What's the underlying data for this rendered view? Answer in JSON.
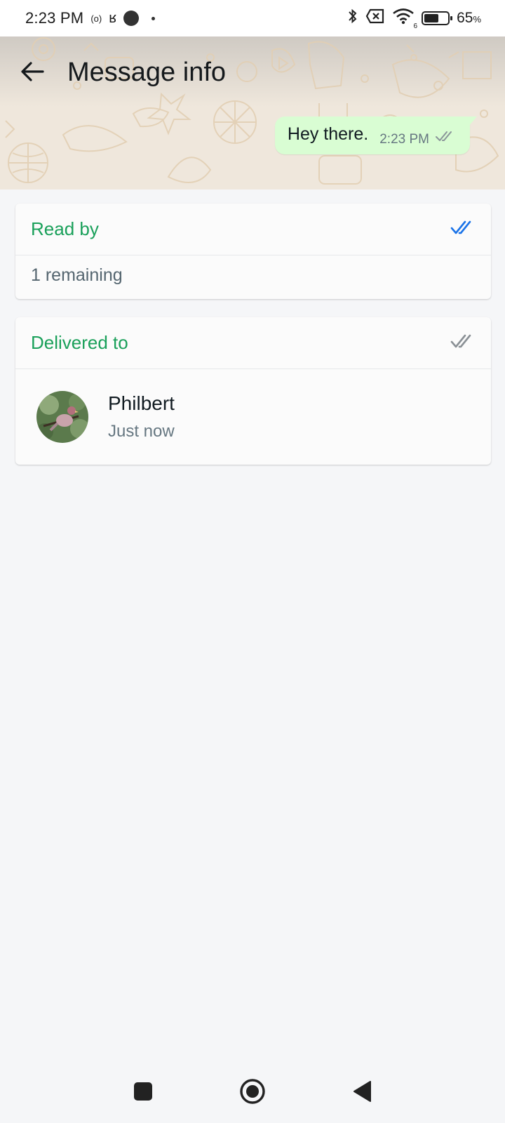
{
  "status_bar": {
    "time": "2:23 PM",
    "radio_indicator": "(o)",
    "extra_glyph": "ʁ",
    "battery_percent": "65",
    "battery_percent_sign": "%",
    "battery_level": 0.65,
    "wifi_badge": "6"
  },
  "header": {
    "title": "Message info",
    "back_icon": "arrow-left-icon"
  },
  "message": {
    "text": "Hey there.",
    "time": "2:23 PM",
    "status_icon": "double-check-icon",
    "bubble_color": "#d9fdd3"
  },
  "read_by": {
    "title": "Read by",
    "remaining": "1 remaining",
    "check_color": "#1a73e8"
  },
  "delivered_to": {
    "title": "Delivered to",
    "check_color": "#8a9095",
    "contacts": [
      {
        "name": "Philbert",
        "time": "Just now"
      }
    ]
  },
  "colors": {
    "accent_green": "#1aa05a",
    "background": "#f5f6f8"
  },
  "nav": {
    "recents_icon": "square-icon",
    "home_icon": "circle-icon",
    "back_icon": "triangle-back-icon"
  }
}
